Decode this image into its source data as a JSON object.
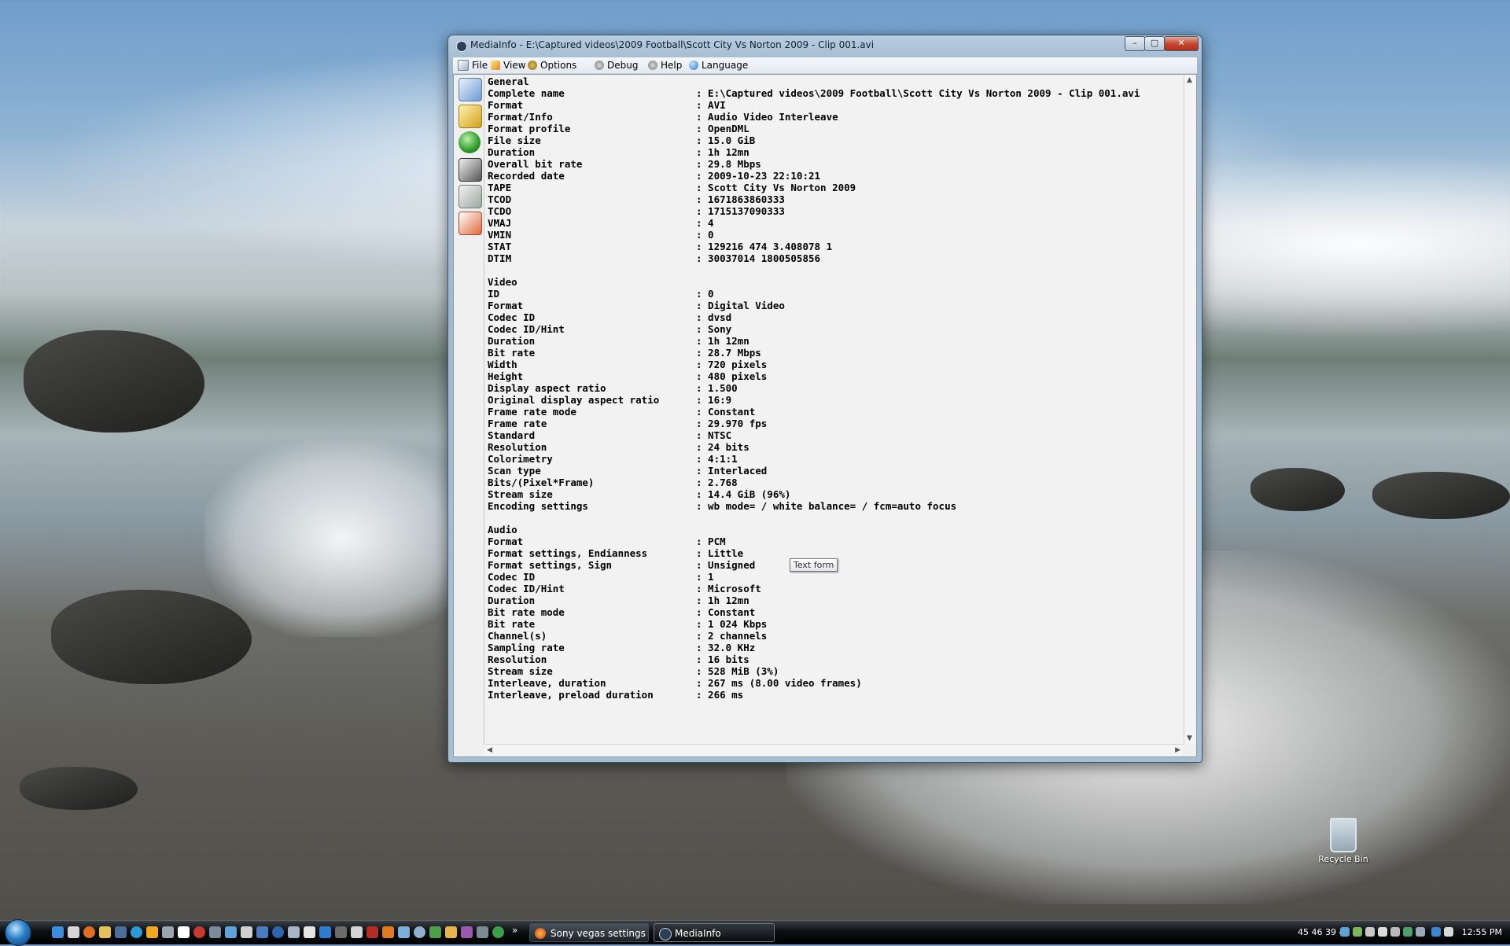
{
  "window": {
    "title": "MediaInfo - E:\\Captured videos\\2009 Football\\Scott City Vs Norton 2009 - Clip 001.avi",
    "buttons": {
      "minimize": "–",
      "maximize": "▢",
      "close": "✕"
    }
  },
  "menu": [
    "File",
    "View",
    "Options",
    "Debug",
    "Help",
    "Language"
  ],
  "sidebar_icons": [
    "open-file-icon",
    "open-folder-icon",
    "go-icon",
    "export-icon",
    "options-icon",
    "about-icon"
  ],
  "report": [
    {
      "k": "General",
      "v": ""
    },
    {
      "k": "Complete name",
      "v": ": E:\\Captured videos\\2009 Football\\Scott City Vs Norton 2009 - Clip 001.avi"
    },
    {
      "k": "Format",
      "v": ": AVI"
    },
    {
      "k": "Format/Info",
      "v": ": Audio Video Interleave"
    },
    {
      "k": "Format profile",
      "v": ": OpenDML"
    },
    {
      "k": "File size",
      "v": ": 15.0 GiB"
    },
    {
      "k": "Duration",
      "v": ": 1h 12mn"
    },
    {
      "k": "Overall bit rate",
      "v": ": 29.8 Mbps"
    },
    {
      "k": "Recorded date",
      "v": ": 2009-10-23 22:10:21"
    },
    {
      "k": "TAPE",
      "v": ": Scott City Vs Norton 2009"
    },
    {
      "k": "TCOD",
      "v": ": 1671863860333"
    },
    {
      "k": "TCDO",
      "v": ": 1715137090333"
    },
    {
      "k": "VMAJ",
      "v": ": 4"
    },
    {
      "k": "VMIN",
      "v": ": 0"
    },
    {
      "k": "STAT",
      "v": ": 129216 474 3.408078 1"
    },
    {
      "k": "DTIM",
      "v": ": 30037014 1800505856"
    },
    {
      "k": "",
      "v": ""
    },
    {
      "k": "Video",
      "v": ""
    },
    {
      "k": "ID",
      "v": ": 0"
    },
    {
      "k": "Format",
      "v": ": Digital Video"
    },
    {
      "k": "Codec ID",
      "v": ": dvsd"
    },
    {
      "k": "Codec ID/Hint",
      "v": ": Sony"
    },
    {
      "k": "Duration",
      "v": ": 1h 12mn"
    },
    {
      "k": "Bit rate",
      "v": ": 28.7 Mbps"
    },
    {
      "k": "Width",
      "v": ": 720 pixels"
    },
    {
      "k": "Height",
      "v": ": 480 pixels"
    },
    {
      "k": "Display aspect ratio",
      "v": ": 1.500"
    },
    {
      "k": "Original display aspect ratio",
      "v": ": 16:9"
    },
    {
      "k": "Frame rate mode",
      "v": ": Constant"
    },
    {
      "k": "Frame rate",
      "v": ": 29.970 fps"
    },
    {
      "k": "Standard",
      "v": ": NTSC"
    },
    {
      "k": "Resolution",
      "v": ": 24 bits"
    },
    {
      "k": "Colorimetry",
      "v": ": 4:1:1"
    },
    {
      "k": "Scan type",
      "v": ": Interlaced"
    },
    {
      "k": "Bits/(Pixel*Frame)",
      "v": ": 2.768"
    },
    {
      "k": "Stream size",
      "v": ": 14.4 GiB (96%)"
    },
    {
      "k": "Encoding settings",
      "v": ": wb mode= / white balance= / fcm=auto focus"
    },
    {
      "k": "",
      "v": ""
    },
    {
      "k": "Audio",
      "v": ""
    },
    {
      "k": "Format",
      "v": ": PCM"
    },
    {
      "k": "Format settings, Endianness",
      "v": ": Little"
    },
    {
      "k": "Format settings, Sign",
      "v": ": Unsigned"
    },
    {
      "k": "Codec ID",
      "v": ": 1"
    },
    {
      "k": "Codec ID/Hint",
      "v": ": Microsoft"
    },
    {
      "k": "Duration",
      "v": ": 1h 12mn"
    },
    {
      "k": "Bit rate mode",
      "v": ": Constant"
    },
    {
      "k": "Bit rate",
      "v": ": 1 024 Kbps"
    },
    {
      "k": "Channel(s)",
      "v": ": 2 channels"
    },
    {
      "k": "Sampling rate",
      "v": ": 32.0 KHz"
    },
    {
      "k": "Resolution",
      "v": ": 16 bits"
    },
    {
      "k": "Stream size",
      "v": ": 528 MiB (3%)"
    },
    {
      "k": "Interleave, duration",
      "v": ": 267 ms (8.00 video frames)"
    },
    {
      "k": "Interleave, preload duration",
      "v": ": 266 ms"
    }
  ],
  "tooltip": "Text form",
  "desktop": {
    "recycle_bin": "Recycle Bin"
  },
  "taskbar": {
    "tasks": [
      {
        "label": "Sony vegas settings ...",
        "active": false
      },
      {
        "label": "MediaInfo",
        "active": true
      }
    ],
    "tray_text": "45 46 39 44",
    "clock": "12:55 PM",
    "overflow": "»"
  },
  "colors": {
    "accent": "#2a7dc6",
    "close": "#c5432b"
  }
}
